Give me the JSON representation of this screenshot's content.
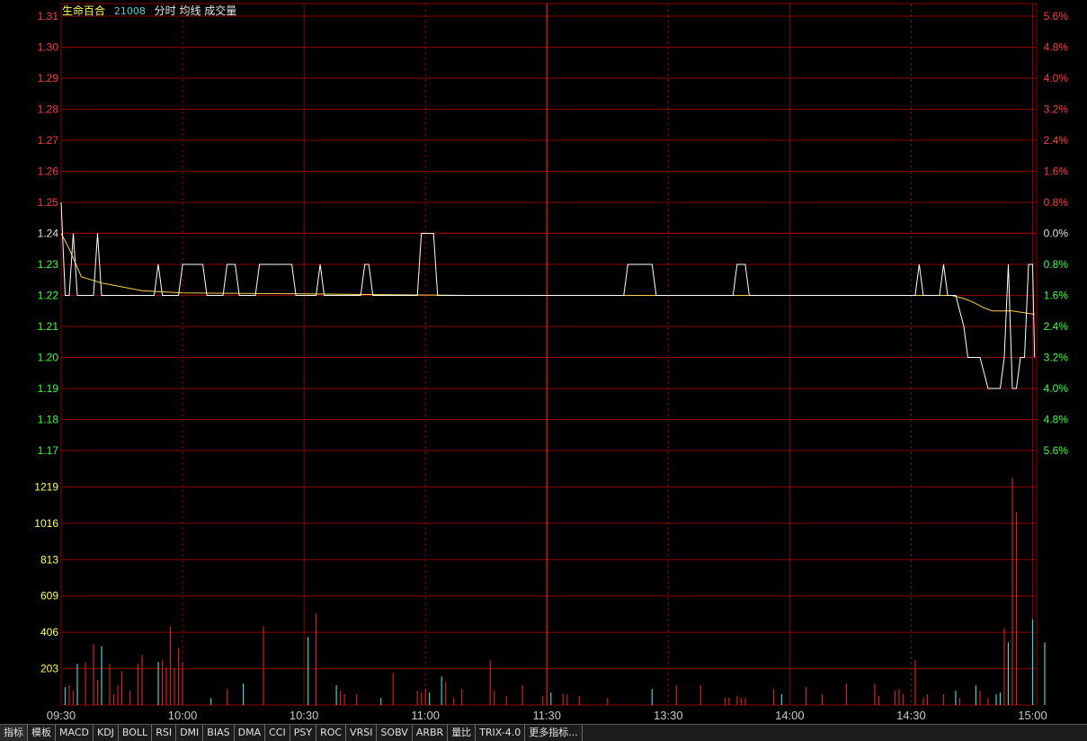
{
  "header": {
    "stock_name": "生命百合",
    "stock_code": "21008",
    "legend": "分时 均线 成交量"
  },
  "colors": {
    "up": "#ff3c3c",
    "down": "#3cff3c",
    "neutral": "#ffff4f",
    "grid": "#8b0000",
    "price_line": "#ffffff",
    "avg_line": "#ffd24a",
    "vol_up": "#d02020",
    "vol_down": "#3fd0d0"
  },
  "chart_data": {
    "type": "line",
    "prev_close": 1.24,
    "price_axis": {
      "ylim": [
        1.17,
        1.31
      ],
      "ticks_left": [
        "1.31",
        "1.30",
        "1.29",
        "1.28",
        "1.27",
        "1.26",
        "1.25",
        "1.24",
        "1.23",
        "1.22",
        "1.21",
        "1.20",
        "1.19",
        "1.18",
        "1.17"
      ],
      "ticks_right": [
        "5.6%",
        "4.8%",
        "4.0%",
        "3.2%",
        "2.4%",
        "1.6%",
        "0.8%",
        "0.0%",
        "0.8%",
        "1.6%",
        "2.4%",
        "3.2%",
        "4.0%",
        "4.8%",
        "5.6%"
      ]
    },
    "volume_axis": {
      "ylim": [
        0,
        1422
      ],
      "ticks": [
        "1219",
        "1016",
        "813",
        "609",
        "406",
        "203"
      ]
    },
    "time_ticks": [
      "09:30",
      "10:00",
      "10:30",
      "11:00",
      "11:30",
      "13:30",
      "14:00",
      "14:30",
      "15:00"
    ],
    "price_series": [
      {
        "m": 0,
        "p": 1.25
      },
      {
        "m": 1,
        "p": 1.22
      },
      {
        "m": 2,
        "p": 1.22
      },
      {
        "m": 3,
        "p": 1.24
      },
      {
        "m": 4,
        "p": 1.22
      },
      {
        "m": 8,
        "p": 1.22
      },
      {
        "m": 9,
        "p": 1.24
      },
      {
        "m": 10,
        "p": 1.22
      },
      {
        "m": 23,
        "p": 1.22
      },
      {
        "m": 24,
        "p": 1.23
      },
      {
        "m": 25,
        "p": 1.22
      },
      {
        "m": 29,
        "p": 1.22
      },
      {
        "m": 30,
        "p": 1.23
      },
      {
        "m": 35,
        "p": 1.23
      },
      {
        "m": 36,
        "p": 1.22
      },
      {
        "m": 40,
        "p": 1.22
      },
      {
        "m": 41,
        "p": 1.23
      },
      {
        "m": 43,
        "p": 1.23
      },
      {
        "m": 44,
        "p": 1.22
      },
      {
        "m": 48,
        "p": 1.22
      },
      {
        "m": 49,
        "p": 1.23
      },
      {
        "m": 57,
        "p": 1.23
      },
      {
        "m": 58,
        "p": 1.22
      },
      {
        "m": 63,
        "p": 1.22
      },
      {
        "m": 64,
        "p": 1.23
      },
      {
        "m": 65,
        "p": 1.22
      },
      {
        "m": 74,
        "p": 1.22
      },
      {
        "m": 75,
        "p": 1.23
      },
      {
        "m": 76,
        "p": 1.23
      },
      {
        "m": 77,
        "p": 1.22
      },
      {
        "m": 88,
        "p": 1.22
      },
      {
        "m": 89,
        "p": 1.24
      },
      {
        "m": 92,
        "p": 1.24
      },
      {
        "m": 93,
        "p": 1.22
      },
      {
        "m": 139,
        "p": 1.22
      },
      {
        "m": 140,
        "p": 1.23
      },
      {
        "m": 146,
        "p": 1.23
      },
      {
        "m": 147,
        "p": 1.22
      },
      {
        "m": 166,
        "p": 1.22
      },
      {
        "m": 167,
        "p": 1.23
      },
      {
        "m": 169,
        "p": 1.23
      },
      {
        "m": 170,
        "p": 1.22
      },
      {
        "m": 211,
        "p": 1.22
      },
      {
        "m": 212,
        "p": 1.23
      },
      {
        "m": 213,
        "p": 1.22
      },
      {
        "m": 217,
        "p": 1.22
      },
      {
        "m": 218,
        "p": 1.23
      },
      {
        "m": 219,
        "p": 1.22
      },
      {
        "m": 221,
        "p": 1.22
      },
      {
        "m": 223,
        "p": 1.21
      },
      {
        "m": 224,
        "p": 1.2
      },
      {
        "m": 227,
        "p": 1.2
      },
      {
        "m": 229,
        "p": 1.19
      },
      {
        "m": 232,
        "p": 1.19
      },
      {
        "m": 233,
        "p": 1.2
      },
      {
        "m": 234,
        "p": 1.23
      },
      {
        "m": 235,
        "p": 1.19
      },
      {
        "m": 236,
        "p": 1.19
      },
      {
        "m": 237,
        "p": 1.2
      },
      {
        "m": 238,
        "p": 1.2
      },
      {
        "m": 239,
        "p": 1.23
      },
      {
        "m": 240,
        "p": 1.23
      },
      {
        "m": 240.5,
        "p": 1.2
      }
    ],
    "avg_series": [
      {
        "m": 0,
        "p": 1.24
      },
      {
        "m": 2,
        "p": 1.235
      },
      {
        "m": 5,
        "p": 1.226
      },
      {
        "m": 10,
        "p": 1.224
      },
      {
        "m": 20,
        "p": 1.2215
      },
      {
        "m": 30,
        "p": 1.2208
      },
      {
        "m": 60,
        "p": 1.2205
      },
      {
        "m": 100,
        "p": 1.22
      },
      {
        "m": 220,
        "p": 1.22
      },
      {
        "m": 223,
        "p": 1.219
      },
      {
        "m": 225,
        "p": 1.218
      },
      {
        "m": 228,
        "p": 1.216
      },
      {
        "m": 230,
        "p": 1.215
      },
      {
        "m": 235,
        "p": 1.215
      },
      {
        "m": 240,
        "p": 1.214
      },
      {
        "m": 240.5,
        "p": 1.214
      }
    ],
    "volume_series": [
      {
        "m": 1,
        "v": 100,
        "d": 1
      },
      {
        "m": 2,
        "v": 110,
        "d": 0
      },
      {
        "m": 3,
        "v": 80,
        "d": 0
      },
      {
        "m": 4,
        "v": 230,
        "d": 1
      },
      {
        "m": 6,
        "v": 240,
        "d": 0
      },
      {
        "m": 8,
        "v": 340,
        "d": 0
      },
      {
        "m": 9,
        "v": 140,
        "d": 0
      },
      {
        "m": 10,
        "v": 330,
        "d": 1
      },
      {
        "m": 12,
        "v": 230,
        "d": 0
      },
      {
        "m": 13,
        "v": 60,
        "d": 0
      },
      {
        "m": 14,
        "v": 110,
        "d": 0
      },
      {
        "m": 15,
        "v": 190,
        "d": 0
      },
      {
        "m": 17,
        "v": 80,
        "d": 0
      },
      {
        "m": 19,
        "v": 230,
        "d": 0
      },
      {
        "m": 20,
        "v": 280,
        "d": 0
      },
      {
        "m": 24,
        "v": 240,
        "d": 1
      },
      {
        "m": 25,
        "v": 250,
        "d": 0
      },
      {
        "m": 26,
        "v": 210,
        "d": 0
      },
      {
        "m": 27,
        "v": 440,
        "d": 0
      },
      {
        "m": 28,
        "v": 210,
        "d": 0
      },
      {
        "m": 29,
        "v": 320,
        "d": 0
      },
      {
        "m": 30,
        "v": 240,
        "d": 0
      },
      {
        "m": 37,
        "v": 40,
        "d": 1
      },
      {
        "m": 41,
        "v": 90,
        "d": 0
      },
      {
        "m": 45,
        "v": 120,
        "d": 1
      },
      {
        "m": 50,
        "v": 440,
        "d": 0
      },
      {
        "m": 61,
        "v": 380,
        "d": 1
      },
      {
        "m": 63,
        "v": 510,
        "d": 0
      },
      {
        "m": 68,
        "v": 110,
        "d": 1
      },
      {
        "m": 69,
        "v": 80,
        "d": 0
      },
      {
        "m": 70,
        "v": 60,
        "d": 0
      },
      {
        "m": 73,
        "v": 60,
        "d": 0
      },
      {
        "m": 79,
        "v": 40,
        "d": 1
      },
      {
        "m": 82,
        "v": 180,
        "d": 0
      },
      {
        "m": 88,
        "v": 80,
        "d": 0
      },
      {
        "m": 89,
        "v": 70,
        "d": 0
      },
      {
        "m": 90,
        "v": 90,
        "d": 0
      },
      {
        "m": 91,
        "v": 70,
        "d": 1
      },
      {
        "m": 94,
        "v": 160,
        "d": 1
      },
      {
        "m": 95,
        "v": 130,
        "d": 0
      },
      {
        "m": 97,
        "v": 40,
        "d": 0
      },
      {
        "m": 99,
        "v": 90,
        "d": 0
      },
      {
        "m": 106,
        "v": 250,
        "d": 0
      },
      {
        "m": 107,
        "v": 80,
        "d": 0
      },
      {
        "m": 110,
        "v": 50,
        "d": 0
      },
      {
        "m": 114,
        "v": 110,
        "d": 0
      },
      {
        "m": 119,
        "v": 50,
        "d": 0
      },
      {
        "m": 121,
        "v": 70,
        "d": 1
      },
      {
        "m": 124,
        "v": 60,
        "d": 0
      },
      {
        "m": 125,
        "v": 60,
        "d": 0
      },
      {
        "m": 128,
        "v": 50,
        "d": 0
      },
      {
        "m": 135,
        "v": 40,
        "d": 0
      },
      {
        "m": 146,
        "v": 90,
        "d": 1
      },
      {
        "m": 152,
        "v": 110,
        "d": 0
      },
      {
        "m": 158,
        "v": 110,
        "d": 0
      },
      {
        "m": 164,
        "v": 40,
        "d": 0
      },
      {
        "m": 165,
        "v": 40,
        "d": 0
      },
      {
        "m": 167,
        "v": 50,
        "d": 0
      },
      {
        "m": 168,
        "v": 40,
        "d": 0
      },
      {
        "m": 169,
        "v": 40,
        "d": 0
      },
      {
        "m": 176,
        "v": 90,
        "d": 0
      },
      {
        "m": 178,
        "v": 60,
        "d": 1
      },
      {
        "m": 184,
        "v": 100,
        "d": 0
      },
      {
        "m": 188,
        "v": 60,
        "d": 0
      },
      {
        "m": 194,
        "v": 120,
        "d": 0
      },
      {
        "m": 201,
        "v": 120,
        "d": 0
      },
      {
        "m": 202,
        "v": 50,
        "d": 0
      },
      {
        "m": 206,
        "v": 80,
        "d": 0
      },
      {
        "m": 207,
        "v": 90,
        "d": 0
      },
      {
        "m": 208,
        "v": 60,
        "d": 0
      },
      {
        "m": 211,
        "v": 250,
        "d": 0
      },
      {
        "m": 213,
        "v": 40,
        "d": 0
      },
      {
        "m": 214,
        "v": 60,
        "d": 0
      },
      {
        "m": 218,
        "v": 60,
        "d": 0
      },
      {
        "m": 221,
        "v": 80,
        "d": 1
      },
      {
        "m": 222,
        "v": 40,
        "d": 0
      },
      {
        "m": 226,
        "v": 110,
        "d": 1
      },
      {
        "m": 227,
        "v": 80,
        "d": 0
      },
      {
        "m": 229,
        "v": 40,
        "d": 0
      },
      {
        "m": 231,
        "v": 60,
        "d": 1
      },
      {
        "m": 232,
        "v": 70,
        "d": 1
      },
      {
        "m": 233,
        "v": 430,
        "d": 0
      },
      {
        "m": 234,
        "v": 350,
        "d": 1
      },
      {
        "m": 235,
        "v": 1270,
        "d": 0
      },
      {
        "m": 236,
        "v": 1080,
        "d": 0
      },
      {
        "m": 240,
        "v": 480,
        "d": 1
      },
      {
        "m": 243,
        "v": 350,
        "d": 1
      }
    ]
  },
  "tabs": [
    "指标",
    "模板",
    "MACD",
    "KDJ",
    "BOLL",
    "RSI",
    "DMI",
    "BIAS",
    "DMA",
    "CCI",
    "PSY",
    "ROC",
    "VRSI",
    "SOBV",
    "ARBR",
    "量比",
    "TRIX-4.0",
    "更多指标..."
  ]
}
